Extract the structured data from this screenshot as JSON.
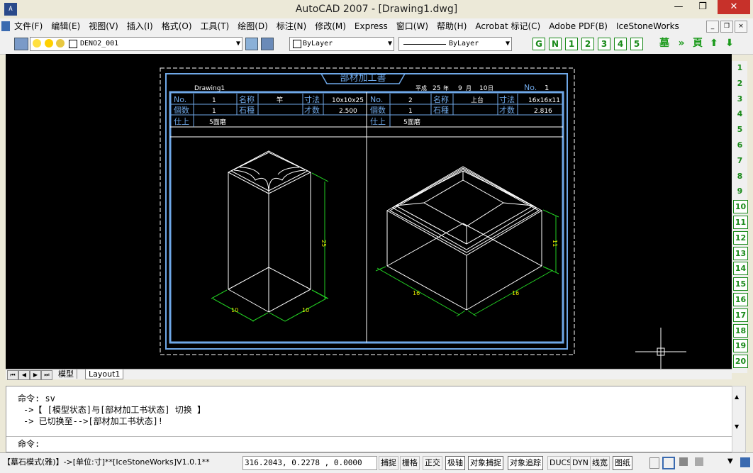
{
  "window": {
    "title": "AutoCAD 2007 - [Drawing1.dwg]",
    "app_icon_text": "A",
    "minimize": "—",
    "restore": "❐",
    "close": "✕"
  },
  "menu": {
    "items": [
      "文件(F)",
      "编辑(E)",
      "视图(V)",
      "插入(I)",
      "格式(O)",
      "工具(T)",
      "绘图(D)",
      "标注(N)",
      "修改(M)",
      "Express",
      "窗口(W)",
      "帮助(H)",
      "Acrobat 标记(C)",
      "Adobe PDF(B)",
      "IceStoneWorks"
    ]
  },
  "toolbar": {
    "layer_name": "DENO2_001",
    "color": "ByLayer",
    "linetype": "ByLayer",
    "buttons": [
      "G",
      "N",
      "1",
      "2",
      "3",
      "4",
      "5"
    ]
  },
  "drawing": {
    "sheet_title": "部材加工書",
    "drawing_name": "Drawing1",
    "date_era": "平成",
    "date_year": "25",
    "date_year_label": "年",
    "date_month": "9",
    "date_month_label": "月",
    "date_day": "10",
    "date_day_label": "日",
    "sheet_no_label": "No.",
    "sheet_no": "1",
    "part1": {
      "no_label": "No.",
      "no": "1",
      "name_label": "名称",
      "name": "竿",
      "size_label": "寸法",
      "size": "10x10x25",
      "qty_label": "個数",
      "qty": "1",
      "material_label": "石種",
      "material": "",
      "volume_label": "才数",
      "volume": "2.500",
      "finish_label": "仕上",
      "finish": "5面磨",
      "dim_height": "25",
      "dim_w1": "10",
      "dim_w2": "10"
    },
    "part2": {
      "no_label": "No.",
      "no": "2",
      "name_label": "名称",
      "name": "上台",
      "size_label": "寸法",
      "size": "16x16x11",
      "qty_label": "個数",
      "qty": "1",
      "material_label": "石種",
      "material": "",
      "volume_label": "才数",
      "volume": "2.816",
      "finish_label": "仕上",
      "finish": "5面磨",
      "dim_height": "11",
      "dim_w1": "16",
      "dim_w2": "16"
    }
  },
  "side_buttons": [
    "1",
    "2",
    "3",
    "4",
    "5",
    "6",
    "7",
    "8",
    "9",
    "10",
    "11",
    "12",
    "13",
    "14",
    "15",
    "16",
    "17",
    "18",
    "19",
    "20"
  ],
  "tabs": {
    "model": "模型",
    "layout": "Layout1"
  },
  "command": {
    "lines": [
      "命令: sv",
      "->【 [模型状态]与[部材加工书状态] 切换 】",
      "-> 已切换至-->[部材加工书状态]!"
    ],
    "prompt": "命令:"
  },
  "status": {
    "mode": "【墓石模式(雅)】->[单位:寸]**[IceStoneWorks]V1.0.1**",
    "coords": "316.2043, 0.2278 , 0.0000",
    "toggles": [
      "捕捉",
      "栅格",
      "正交",
      "极轴",
      "对象捕捉",
      "对象追踪",
      "DUCS",
      "DYN",
      "线宽",
      "图纸"
    ]
  },
  "colors": {
    "frame": "#6fa8e8",
    "line": "#ffffff",
    "dimension": "#22cc22",
    "dim_text": "#e8e800",
    "side_button": "#1a8a1a"
  }
}
